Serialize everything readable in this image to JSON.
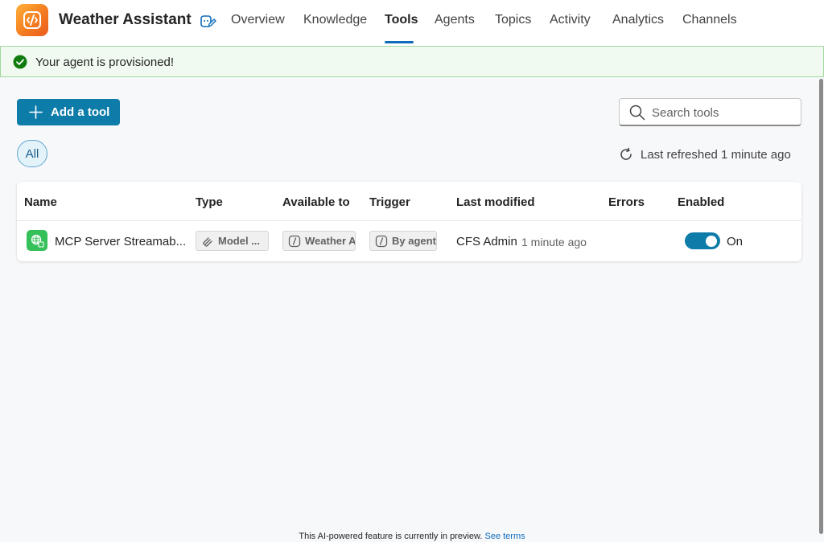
{
  "header": {
    "app_title": "Weather Assistant",
    "tabs": [
      {
        "label": "Overview"
      },
      {
        "label": "Knowledge"
      },
      {
        "label": "Tools",
        "active": true
      },
      {
        "label": "Agents"
      },
      {
        "label": "Topics"
      },
      {
        "label": "Activity"
      },
      {
        "label": "Analytics"
      },
      {
        "label": "Channels"
      }
    ]
  },
  "banner": {
    "message": "Your agent is provisioned!",
    "status": "success"
  },
  "toolbar": {
    "add_label": "Add a tool",
    "search_placeholder": "Search tools",
    "filter_label": "All",
    "refresh_text": "Last refreshed 1 minute ago"
  },
  "table": {
    "columns": [
      "Name",
      "Type",
      "Available to",
      "Trigger",
      "Last modified",
      "Errors",
      "Enabled"
    ],
    "rows": [
      {
        "name": "MCP Server Streamab...",
        "type": "Model ...",
        "available_to": "Weather Assistant",
        "trigger": "By agent",
        "modified_by": "CFS Admin",
        "modified_time": "1 minute ago",
        "errors": "",
        "enabled": true,
        "enabled_label": "On"
      }
    ]
  },
  "footer": {
    "text": "This AI-powered feature is currently in preview.",
    "link": "See terms"
  },
  "colors": {
    "accent": "#0e7ca8",
    "nav_underline": "#0f6cbd",
    "success": "#107c10",
    "tool_icon": "#35c05a"
  },
  "icons": {
    "app_logo": "code-brackets-icon",
    "edit": "edit-agent-icon",
    "banner": "check-circle-icon",
    "add": "plus-icon",
    "search": "search-icon",
    "refresh": "refresh-icon",
    "tool": "globe-icon",
    "type": "model-icon",
    "available_to": "agent-icon",
    "trigger": "agent-icon"
  }
}
